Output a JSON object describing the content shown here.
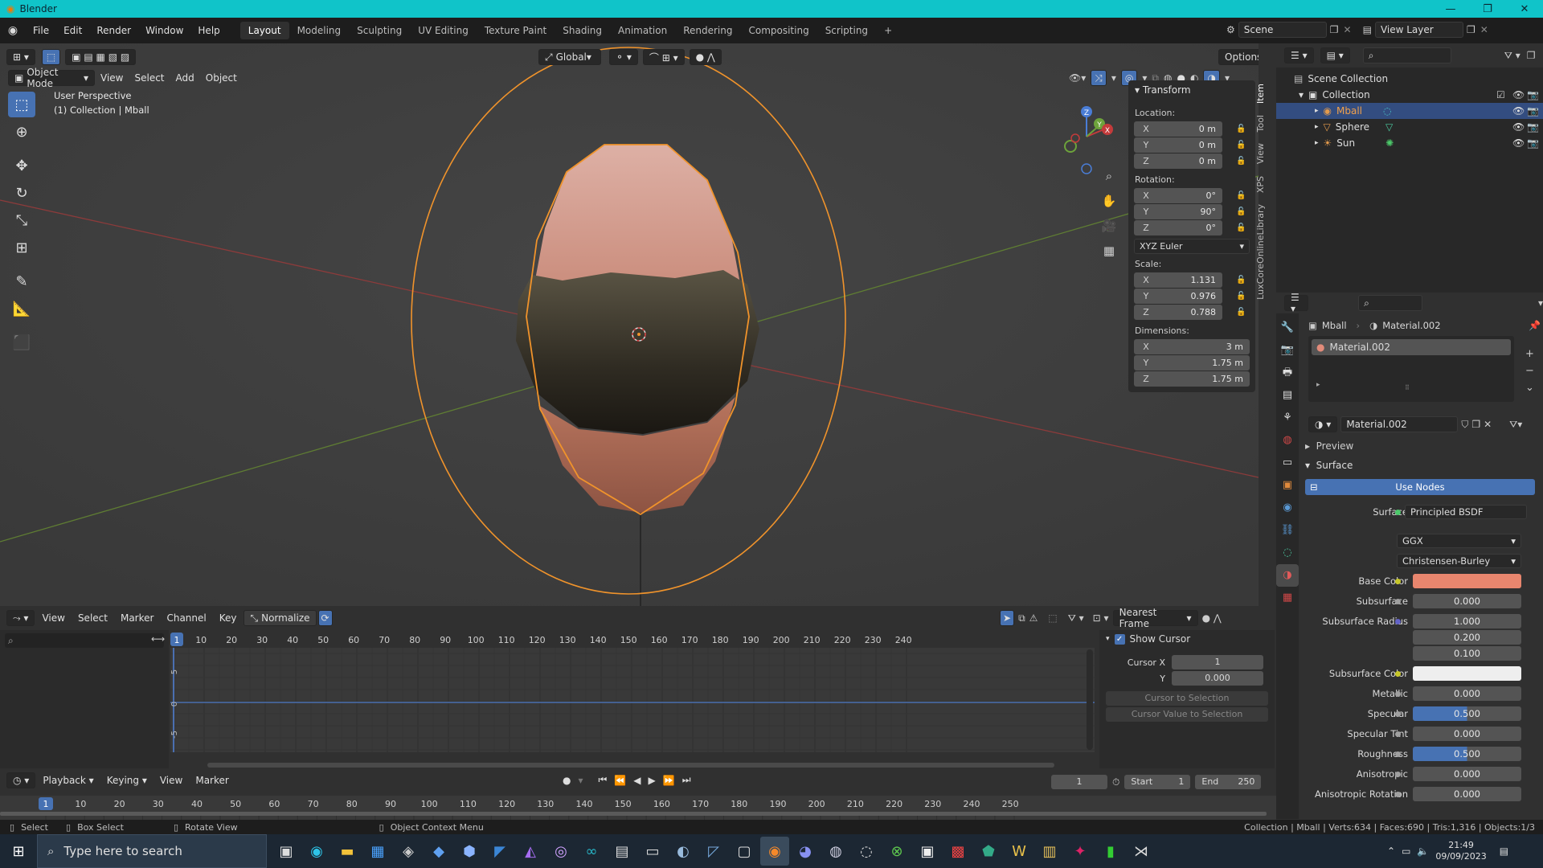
{
  "window": {
    "title": "Blender"
  },
  "menubar": {
    "menus": [
      "File",
      "Edit",
      "Render",
      "Window",
      "Help"
    ],
    "workspaces": [
      "Layout",
      "Modeling",
      "Sculpting",
      "UV Editing",
      "Texture Paint",
      "Shading",
      "Animation",
      "Rendering",
      "Compositing",
      "Scripting"
    ],
    "active_workspace": "Layout",
    "add_tab": "+",
    "scene": "Scene",
    "view_layer": "View Layer"
  },
  "viewport": {
    "mode": "Object Mode",
    "menus": [
      "View",
      "Select",
      "Add",
      "Object"
    ],
    "transform_orientation": "Global",
    "options": "Options",
    "info_line1": "User Perspective",
    "info_line2": "(1) Collection | Mball",
    "gizmo_axes": [
      "Z",
      "Y",
      "X"
    ],
    "ellipse_color": "#f0932b"
  },
  "npanel": {
    "tabs": [
      "Item",
      "Tool",
      "View",
      "XPS",
      "LuxCoreOnlineLibrary"
    ],
    "header": "Transform",
    "location_label": "Location:",
    "location": [
      {
        "axis": "X",
        "value": "0 m"
      },
      {
        "axis": "Y",
        "value": "0 m"
      },
      {
        "axis": "Z",
        "value": "0 m"
      }
    ],
    "rotation_label": "Rotation:",
    "rotation": [
      {
        "axis": "X",
        "value": "0°"
      },
      {
        "axis": "Y",
        "value": "90°"
      },
      {
        "axis": "Z",
        "value": "0°"
      }
    ],
    "rotation_mode": "XYZ Euler",
    "scale_label": "Scale:",
    "scale": [
      {
        "axis": "X",
        "value": "1.131"
      },
      {
        "axis": "Y",
        "value": "0.976"
      },
      {
        "axis": "Z",
        "value": "0.788"
      }
    ],
    "dimensions_label": "Dimensions:",
    "dimensions": [
      {
        "axis": "X",
        "value": "3 m"
      },
      {
        "axis": "Y",
        "value": "1.75 m"
      },
      {
        "axis": "Z",
        "value": "1.75 m"
      }
    ]
  },
  "outliner": {
    "scene_collection": "Scene Collection",
    "collection": "Collection",
    "items": [
      {
        "name": "Mball",
        "icon": "metaball-icon",
        "color": "#e29a4c"
      },
      {
        "name": "Sphere",
        "icon": "mesh-icon",
        "color": "#e29a4c"
      },
      {
        "name": "Sun",
        "icon": "light-icon",
        "color": "#e29a4c"
      }
    ]
  },
  "properties": {
    "breadcrumb_object": "Mball",
    "breadcrumb_material": "Material.002",
    "slot": "Material.002",
    "material_name": "Material.002",
    "preview": "Preview",
    "surface_panel": "Surface",
    "use_nodes": "Use Nodes",
    "surface_label": "Surface",
    "surface_value": "Principled BSDF",
    "distribution": "GGX",
    "subsurface_method": "Christensen-Burley",
    "base_color_label": "Base Color",
    "base_color": "#e8866e",
    "subsurface_label": "Subsurface",
    "subsurface": "0.000",
    "subsurface_radius_label": "Subsurface Radius",
    "subsurface_radius": [
      "1.000",
      "0.200",
      "0.100"
    ],
    "subsurface_color_label": "Subsurface Color",
    "subsurface_color": "#eeeeee",
    "metallic_label": "Metallic",
    "metallic": "0.000",
    "specular_label": "Specular",
    "specular": "0.500",
    "specular_tint_label": "Specular Tint",
    "specular_tint": "0.000",
    "roughness_label": "Roughness",
    "roughness": "0.500",
    "anisotropic_label": "Anisotropic",
    "anisotropic": "0.000",
    "anisotropic_rotation_label": "Anisotropic Rotation",
    "anisotropic_rotation": "0.000"
  },
  "graph_editor": {
    "menus": [
      "View",
      "Select",
      "Marker",
      "Channel",
      "Key"
    ],
    "normalize": "Normalize",
    "snap": "Nearest Frame",
    "frame_numbers": [
      "10",
      "20",
      "30",
      "40",
      "50",
      "60",
      "70",
      "80",
      "90",
      "100",
      "110",
      "120",
      "130",
      "140",
      "150",
      "160",
      "170",
      "180",
      "190",
      "200",
      "210",
      "220",
      "230",
      "240"
    ],
    "current_frame": "1",
    "y_ticks": [
      "5",
      "0",
      "-5"
    ],
    "show_cursor": "Show Cursor",
    "cursor_x_label": "Cursor X",
    "cursor_x": "1",
    "cursor_y_label": "Y",
    "cursor_y": "0.000",
    "cursor_to_selection": "Cursor to Selection",
    "cursor_value_to_selection": "Cursor Value to Selection"
  },
  "timeline": {
    "menus": [
      "Playback",
      "Keying",
      "View",
      "Marker"
    ],
    "current_frame": "1",
    "start_label": "Start",
    "start": "1",
    "end_label": "End",
    "end": "250",
    "frame_numbers": [
      "10",
      "20",
      "30",
      "40",
      "50",
      "60",
      "70",
      "80",
      "90",
      "100",
      "110",
      "120",
      "130",
      "140",
      "150",
      "160",
      "170",
      "180",
      "190",
      "200",
      "210",
      "220",
      "230",
      "240",
      "250"
    ]
  },
  "statusbar": {
    "select": "Select",
    "box_select": "Box Select",
    "rotate_view": "Rotate View",
    "context_menu": "Object Context Menu",
    "stats": "Collection | Mball | Verts:634 | Faces:690 | Tris:1,316 | Objects:1/3"
  },
  "taskbar": {
    "search_placeholder": "Type here to search",
    "time": "21:49",
    "date": "09/09/2023"
  }
}
